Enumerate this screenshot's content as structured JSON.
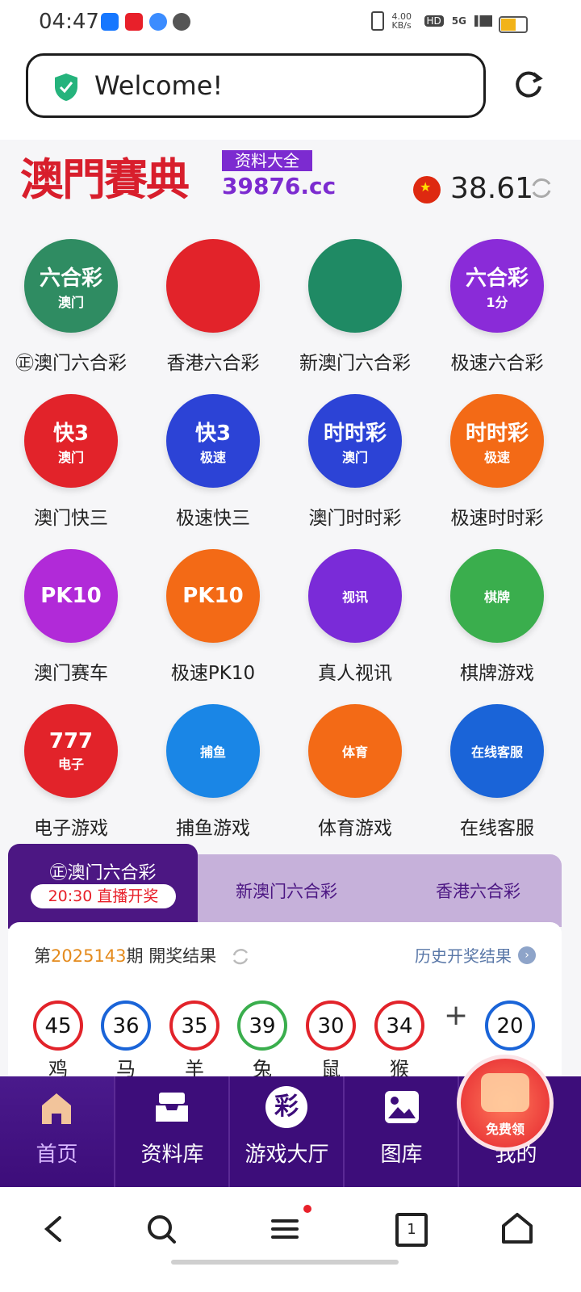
{
  "status_bar": {
    "time": "04:47",
    "net_speed": "4.00 KB/s",
    "hd": "HD",
    "signal": "5G"
  },
  "browser": {
    "url_text": "Welcome!"
  },
  "header": {
    "logo_main": "澳門賽典",
    "logo_sub": "资料大全",
    "logo_domain": "39876.cc",
    "balance": "38.61"
  },
  "grid": [
    {
      "label": "㊣澳门六合彩",
      "icon_text": "六合彩",
      "icon_sub": "澳门",
      "color": "#2f8c62"
    },
    {
      "label": "香港六合彩",
      "icon_text": "",
      "icon_sub": "",
      "color": "#e2232a"
    },
    {
      "label": "新澳门六合彩",
      "icon_text": "",
      "icon_sub": "",
      "color": "#1f8a64"
    },
    {
      "label": "极速六合彩",
      "icon_text": "六合彩",
      "icon_sub": "1分",
      "color": "#8a2bd8"
    },
    {
      "label": "澳门快三",
      "icon_text": "快3",
      "icon_sub": "澳门",
      "color": "#e2232a"
    },
    {
      "label": "极速快三",
      "icon_text": "快3",
      "icon_sub": "极速",
      "color": "#2c43d6"
    },
    {
      "label": "澳门时时彩",
      "icon_text": "时时彩",
      "icon_sub": "澳门",
      "color": "#2c43d6"
    },
    {
      "label": "极速时时彩",
      "icon_text": "时时彩",
      "icon_sub": "极速",
      "color": "#f36a16"
    },
    {
      "label": "澳门赛车",
      "icon_text": "PK10",
      "icon_sub": "",
      "color": "#b12ad8"
    },
    {
      "label": "极速PK10",
      "icon_text": "PK10",
      "icon_sub": "",
      "color": "#f36a16"
    },
    {
      "label": "真人视讯",
      "icon_text": "",
      "icon_sub": "视讯",
      "color": "#7a2bd8"
    },
    {
      "label": "棋牌游戏",
      "icon_text": "",
      "icon_sub": "棋牌",
      "color": "#3aae4d"
    },
    {
      "label": "电子游戏",
      "icon_text": "777",
      "icon_sub": "电子",
      "color": "#e2232a"
    },
    {
      "label": "捕鱼游戏",
      "icon_text": "",
      "icon_sub": "捕鱼",
      "color": "#1a86e6"
    },
    {
      "label": "体育游戏",
      "icon_text": "",
      "icon_sub": "体育",
      "color": "#f36a16"
    },
    {
      "label": "在线客服",
      "icon_text": "",
      "icon_sub": "在线客服",
      "color": "#1a64d8"
    }
  ],
  "tabs": {
    "active_label": "㊣澳门六合彩",
    "live_badge": "20:30 直播开奖",
    "tab2": "新澳门六合彩",
    "tab3": "香港六合彩"
  },
  "results": {
    "period_prefix": "第",
    "period_number": "2025143",
    "period_suffix": "期 開奖结果",
    "history_link": "历史开奖结果",
    "plus": "+",
    "balls": [
      {
        "number": "45",
        "zodiac": "鸡",
        "color": "#e2232a"
      },
      {
        "number": "36",
        "zodiac": "马",
        "color": "#1a64d8"
      },
      {
        "number": "35",
        "zodiac": "羊",
        "color": "#e2232a"
      },
      {
        "number": "39",
        "zodiac": "兔",
        "color": "#3aae4d"
      },
      {
        "number": "30",
        "zodiac": "鼠",
        "color": "#e2232a"
      },
      {
        "number": "34",
        "zodiac": "猴",
        "color": "#e2232a"
      }
    ],
    "special": {
      "number": "20",
      "color": "#1a64d8"
    }
  },
  "app_nav": [
    {
      "label": "首页"
    },
    {
      "label": "资料库"
    },
    {
      "label": "游戏大厅"
    },
    {
      "label": "图库"
    },
    {
      "label": "我的"
    }
  ],
  "red_packet": {
    "label": "免费领"
  },
  "system_nav": {
    "tabs_count": "1"
  }
}
